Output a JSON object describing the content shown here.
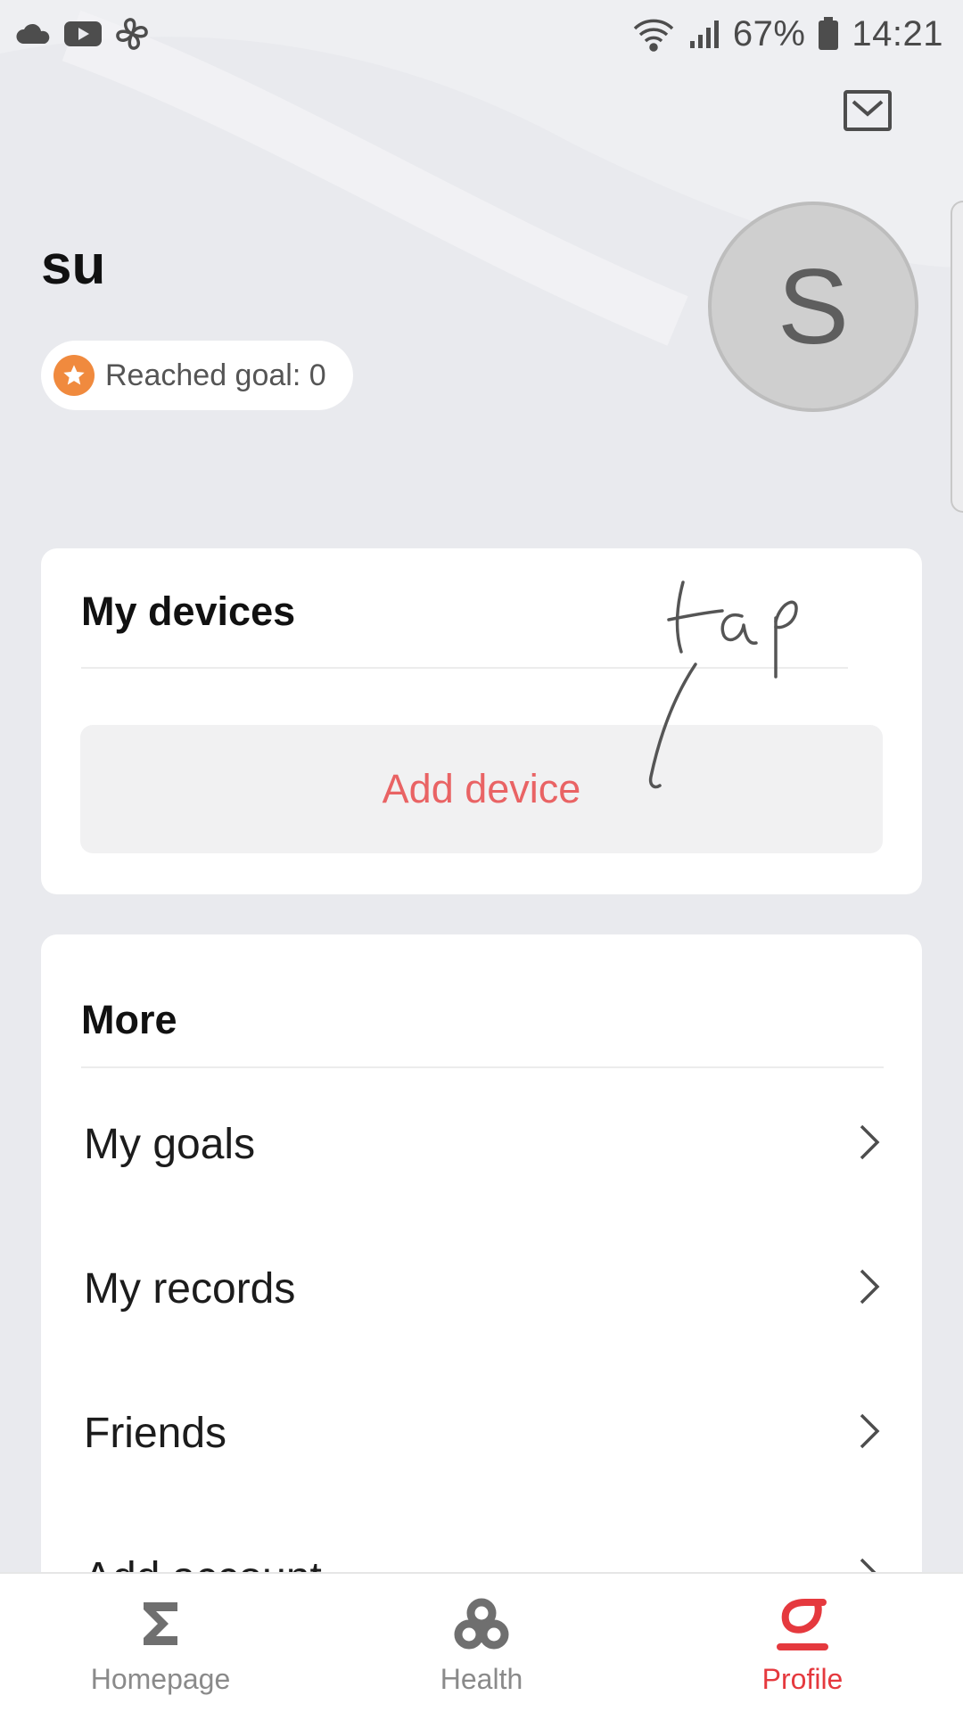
{
  "status_bar": {
    "battery": "67%",
    "time": "14:21",
    "left_icons": [
      "cloud-icon",
      "youtube-icon",
      "pinwheel-icon"
    ],
    "right_icons": [
      "wifi-icon",
      "signal-icon",
      "battery-icon"
    ]
  },
  "header": {
    "mail_icon": "mail-icon"
  },
  "profile": {
    "name": "su",
    "goal_label": "Reached goal: 0",
    "avatar_initial": "S"
  },
  "devices": {
    "title": "My devices",
    "add_button": "Add device",
    "handwritten_note": "tap"
  },
  "more": {
    "title": "More",
    "items": [
      {
        "label": "My goals"
      },
      {
        "label": "My records"
      },
      {
        "label": "Friends"
      },
      {
        "label": "Add account"
      }
    ]
  },
  "bottom_nav": {
    "items": [
      {
        "label": "Homepage",
        "icon": "sigma-icon",
        "active": false
      },
      {
        "label": "Health",
        "icon": "health-icon",
        "active": false
      },
      {
        "label": "Profile",
        "icon": "profile-icon",
        "active": true
      }
    ]
  },
  "colors": {
    "accent": "#e5393e",
    "add_device_text": "#e96364",
    "goal_star": "#f08a3e",
    "background": "#e9eaee"
  }
}
